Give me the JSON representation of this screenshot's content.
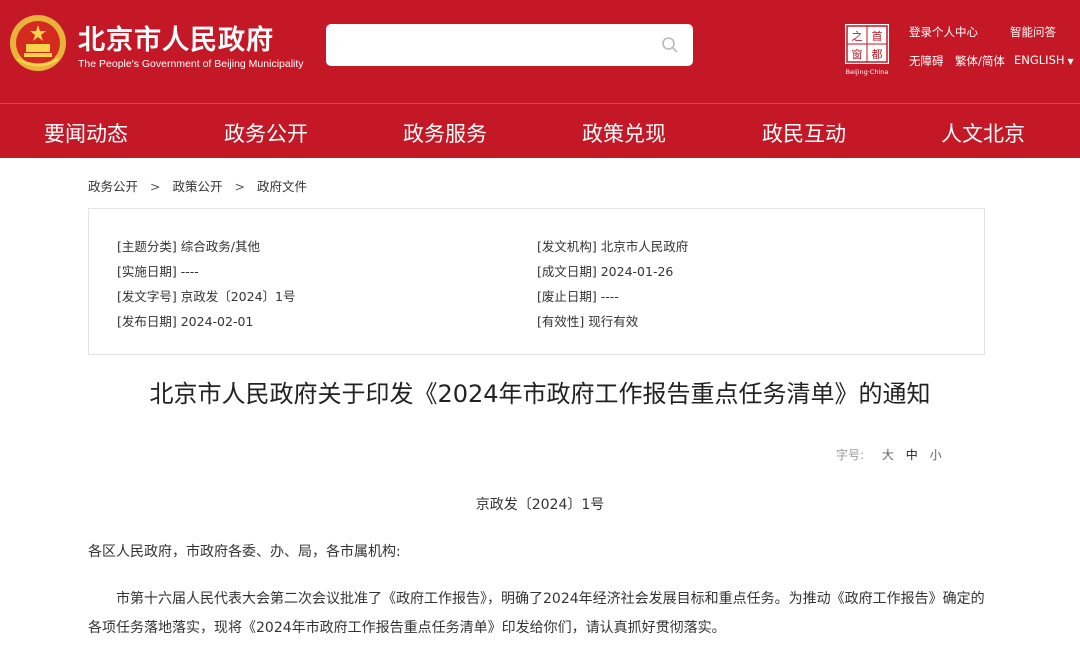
{
  "header": {
    "site_title": "北京市人民政府",
    "site_subtitle": "The People's Government of Beijing Municipality",
    "search_placeholder": "",
    "capital_logo": {
      "chars": [
        "首",
        "都",
        "之",
        "窗"
      ],
      "caption": "Beijing·China"
    },
    "top_links": {
      "login": "登录个人中心",
      "smart_qa": "智能问答",
      "accessible": "无障碍",
      "trad_simp": "繁体/简体",
      "english": "ENGLISH"
    },
    "colors": {
      "brand_red": "#c41826"
    }
  },
  "nav": {
    "items": [
      "要闻动态",
      "政务公开",
      "政务服务",
      "政策兑现",
      "政民互动",
      "人文北京"
    ]
  },
  "breadcrumb": {
    "items": [
      "政务公开",
      "政策公开",
      "政府文件"
    ],
    "separator": ">"
  },
  "info": {
    "left": [
      "[主题分类] 综合政务/其他",
      "[实施日期] ----",
      "[发文字号] 京政发〔2024〕1号",
      "[发布日期] 2024-02-01"
    ],
    "right": [
      "[发文机构] 北京市人民政府",
      "[成文日期] 2024-01-26",
      "[废止日期] ----",
      "[有效性] 现行有效"
    ]
  },
  "document": {
    "title": "北京市人民政府关于印发《2024年市政府工作报告重点任务清单》的通知",
    "font_size_label": "字号:",
    "font_size_options": [
      "大",
      "中",
      "小"
    ],
    "doc_number": "京政发〔2024〕1号",
    "salutation": "各区人民政府，市政府各委、办、局，各市属机构:",
    "paragraph": "市第十六届人民代表大会第二次会议批准了《政府工作报告》，明确了2024年经济社会发展目标和重点任务。为推动《政府工作报告》确定的各项任务落地落实，现将《2024年市政府工作报告重点任务清单》印发给你们，请认真抓好贯彻落实。"
  }
}
